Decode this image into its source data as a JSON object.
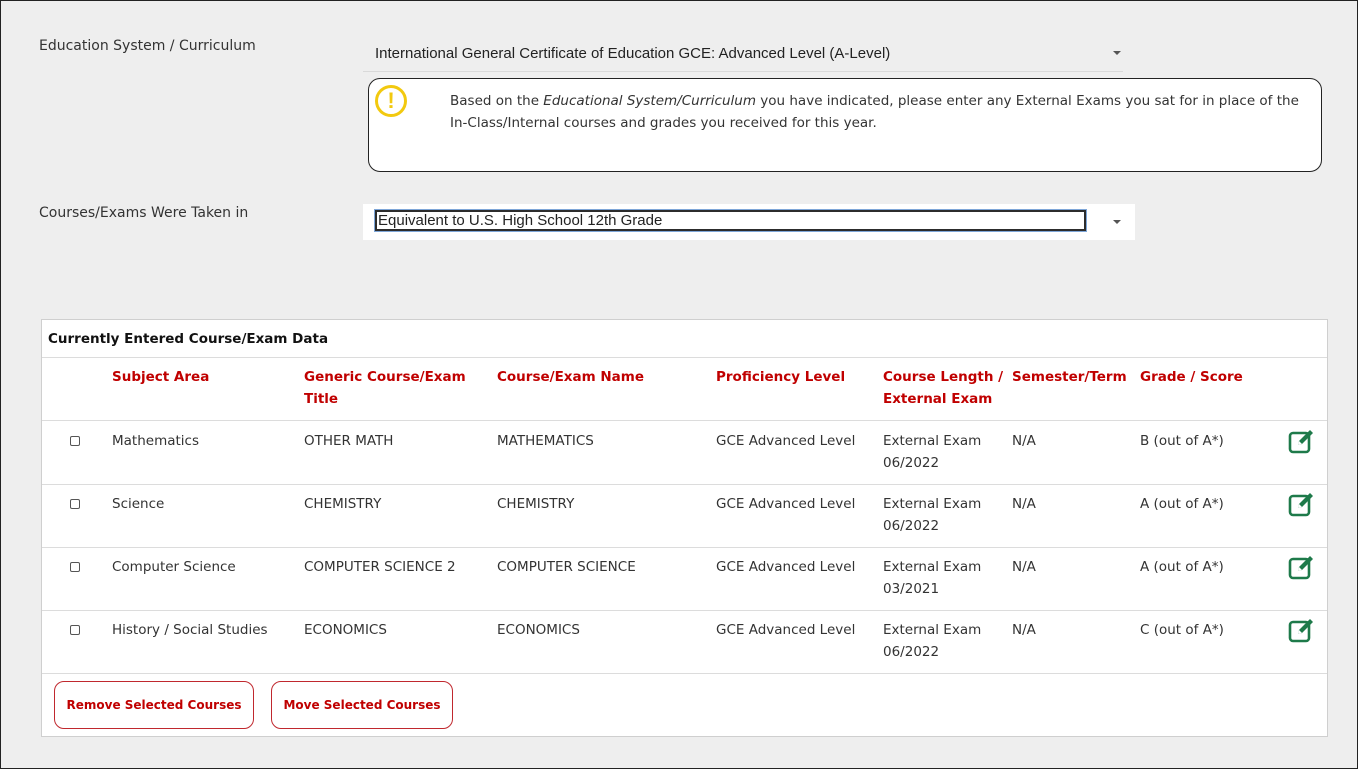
{
  "form": {
    "curriculum_label": "Education System / Curriculum",
    "curriculum_value": "International General Certificate of Education GCE: Advanced Level (A-Level)",
    "notice": {
      "icon": "exclamation-circle-icon",
      "text_prefix": "Based on the ",
      "text_emphasis": "Educational System/Curriculum",
      "text_suffix": " you have indicated, please enter any External Exams you sat for in place of the In-Class/Internal courses and grades you received for this year."
    },
    "taken_label": "Courses/Exams Were Taken in",
    "taken_value": "Equivalent to U.S. High School 12th Grade"
  },
  "table": {
    "title": "Currently Entered Course/Exam Data",
    "columns": {
      "subject": "Subject Area",
      "generic": "Generic Course/Exam Title",
      "name": "Course/Exam Name",
      "level": "Proficiency Level",
      "length": "Course Length / External Exam",
      "term": "Semester/Term",
      "grade": "Grade / Score"
    },
    "rows": [
      {
        "subject": "Mathematics",
        "generic": "OTHER MATH",
        "name": "MATHEMATICS",
        "level": "GCE Advanced Level",
        "length": "External Exam",
        "date": "06/2022",
        "term": "N/A",
        "grade": "B (out of A*)"
      },
      {
        "subject": "Science",
        "generic": "CHEMISTRY",
        "name": "CHEMISTRY",
        "level": "GCE Advanced Level",
        "length": "External Exam",
        "date": "06/2022",
        "term": "N/A",
        "grade": "A (out of A*)"
      },
      {
        "subject": "Computer Science",
        "generic": "COMPUTER SCIENCE 2",
        "name": "COMPUTER SCIENCE",
        "level": "GCE Advanced Level",
        "length": "External Exam",
        "date": "03/2021",
        "term": "N/A",
        "grade": "A (out of A*)"
      },
      {
        "subject": "History / Social Studies",
        "generic": "ECONOMICS",
        "name": "ECONOMICS",
        "level": "GCE Advanced Level",
        "length": "External Exam",
        "date": "06/2022",
        "term": "N/A",
        "grade": "C (out of A*)"
      }
    ],
    "edit_icon": "edit-icon",
    "edit_color": "#1e7a4a"
  },
  "actions": {
    "remove_label": "Remove Selected Courses",
    "move_label": "Move Selected Courses"
  },
  "colors": {
    "header_red": "#c00000",
    "warning_yellow": "#f2c90f"
  }
}
